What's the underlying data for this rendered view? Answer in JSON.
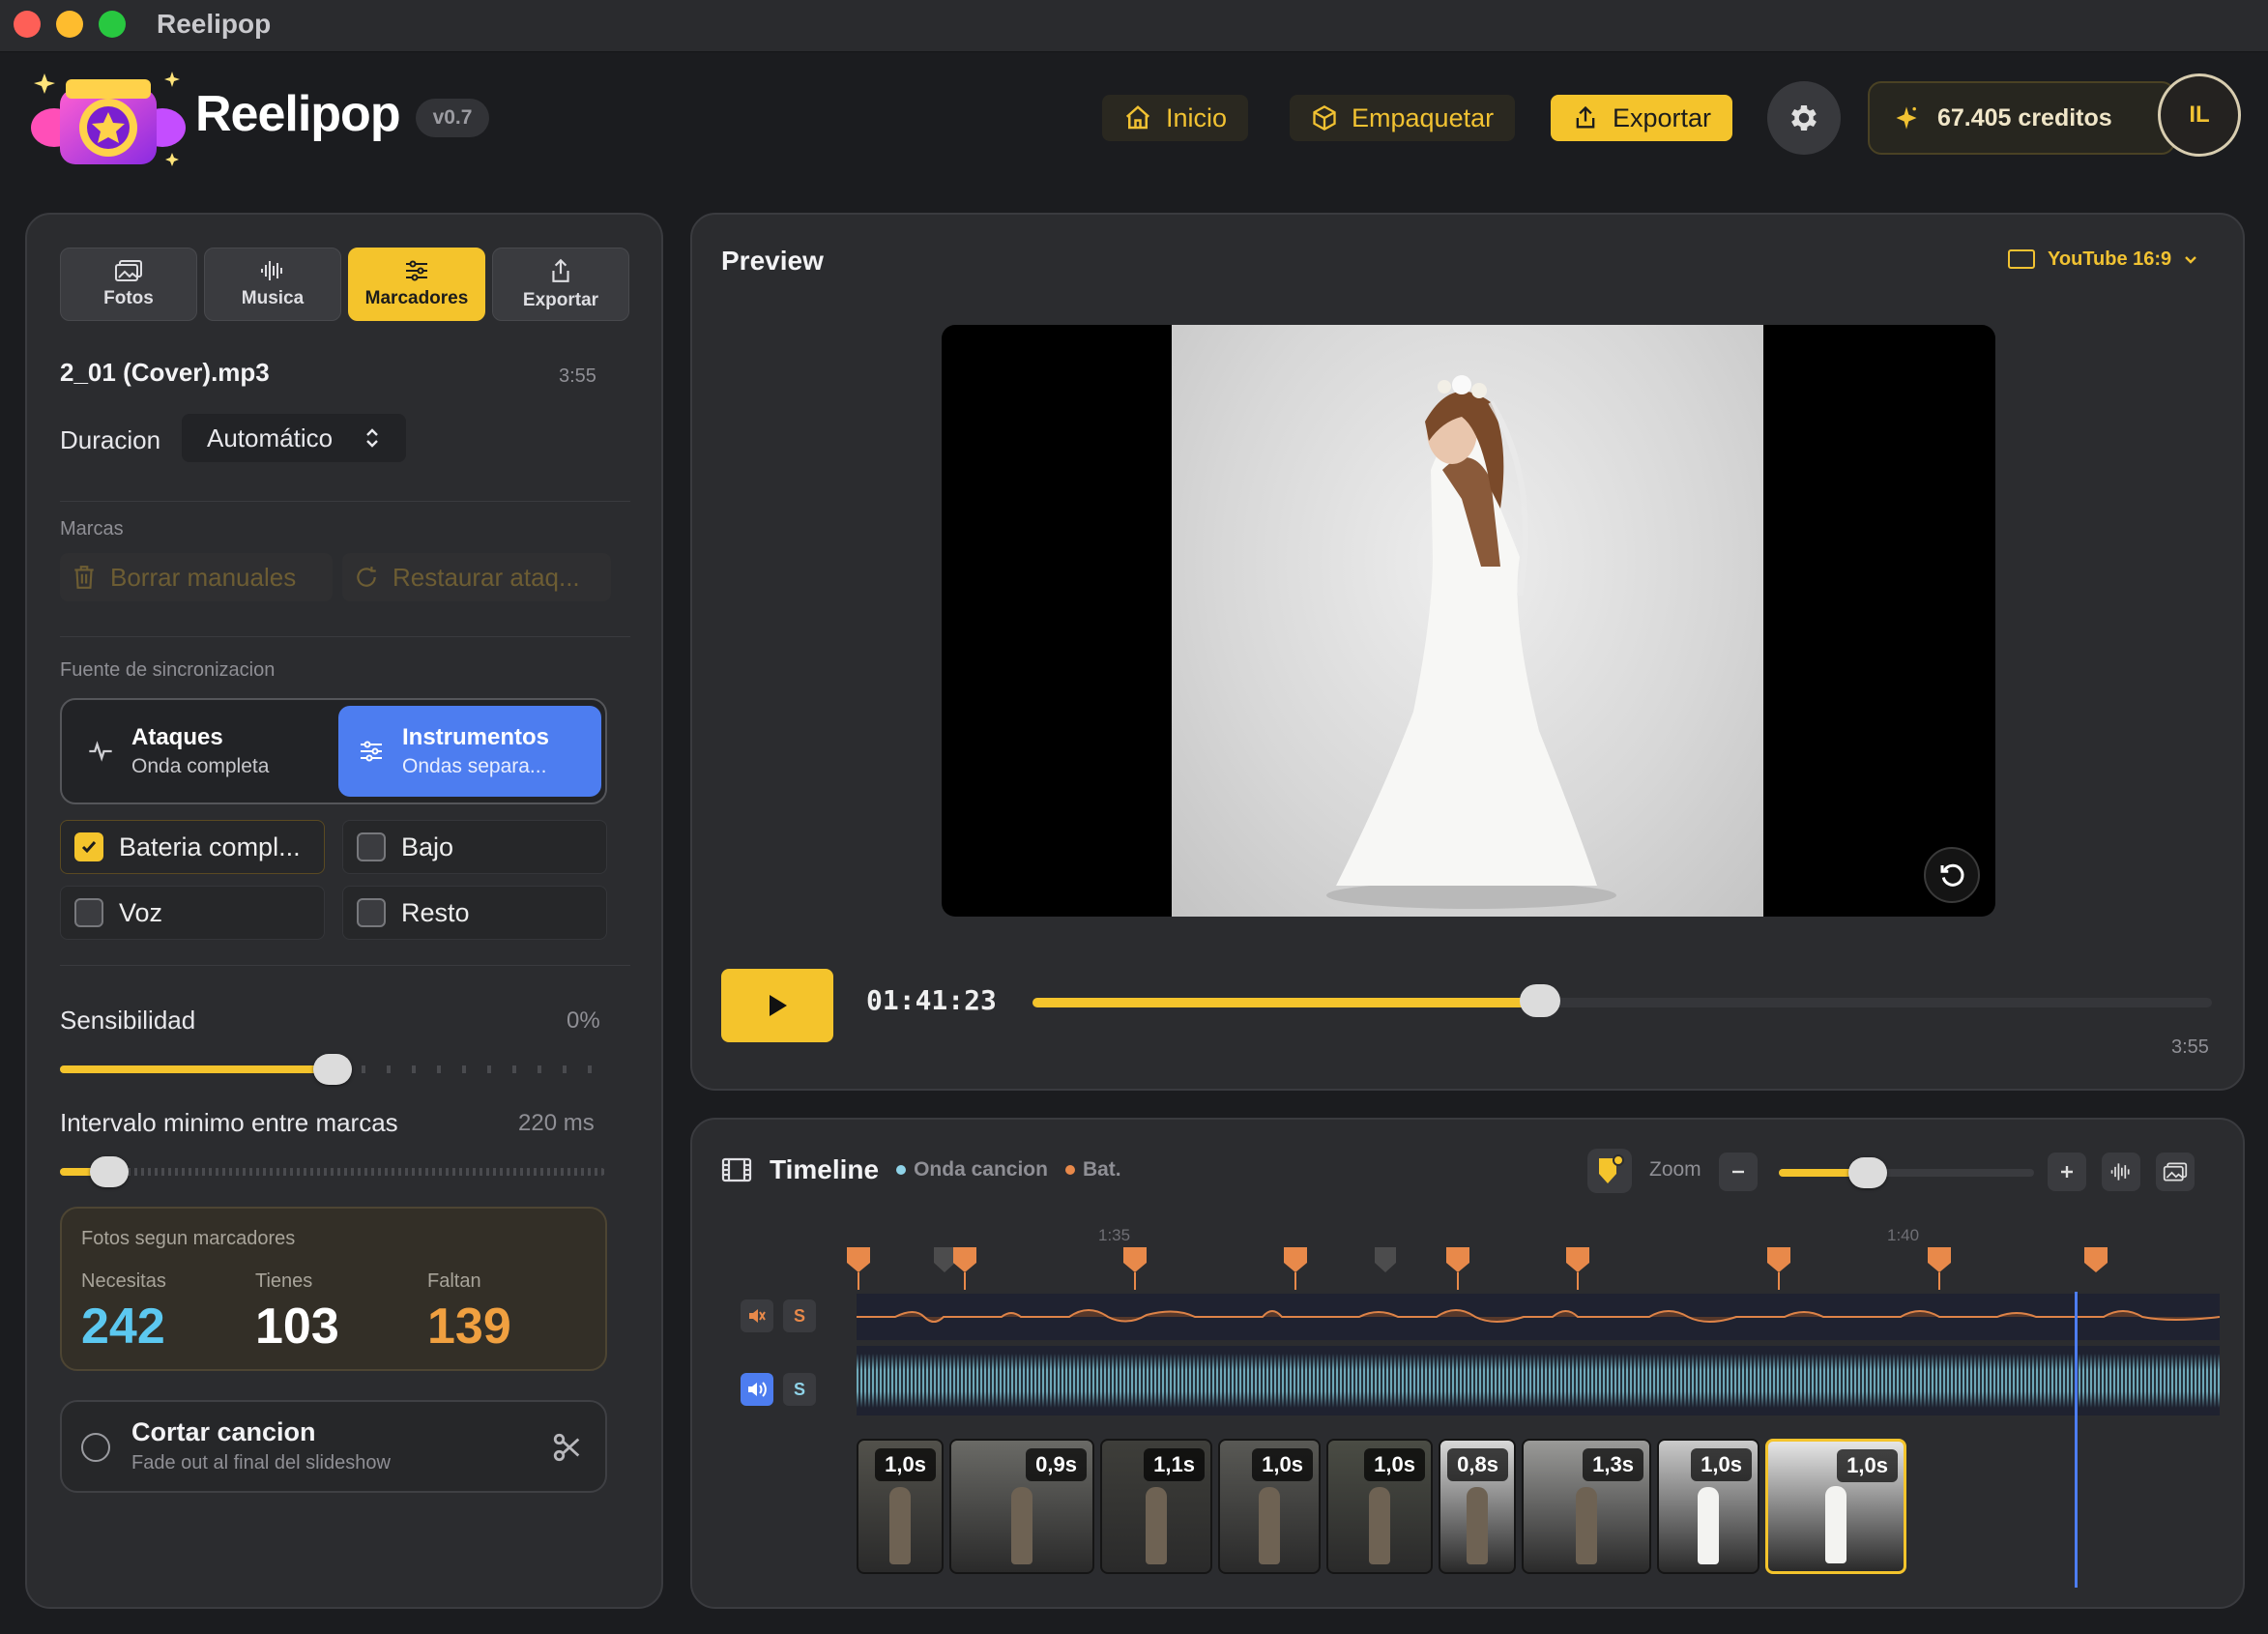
{
  "window": {
    "title": "Reelipop"
  },
  "header": {
    "brand": "Reelipop",
    "version": "v0.7",
    "nav": {
      "inicio": "Inicio",
      "empaquetar": "Empaquetar",
      "exportar": "Exportar"
    },
    "credits": "67.405 creditos",
    "avatar": "IL"
  },
  "sidebar": {
    "tabs": [
      {
        "label": "Fotos",
        "icon": "photos-icon"
      },
      {
        "label": "Musica",
        "icon": "waveform-icon"
      },
      {
        "label": "Marcadores",
        "icon": "sliders-icon"
      },
      {
        "label": "Exportar",
        "icon": "share-icon"
      }
    ],
    "active_tab": "Marcadores",
    "song": {
      "name": "2_01 (Cover).mp3",
      "duration": "3:55"
    },
    "duration_label": "Duracion",
    "duration_value": "Automático",
    "marks_label": "Marcas",
    "marks_buttons": {
      "clear": "Borrar manuales",
      "restore": "Restaurar ataq..."
    },
    "sync_label": "Fuente de sincronizacion",
    "sync_options": [
      {
        "title": "Ataques",
        "subtitle": "Onda completa",
        "selected": false
      },
      {
        "title": "Instrumentos",
        "subtitle": "Ondas separa...",
        "selected": true
      }
    ],
    "stems": [
      {
        "label": "Bateria compl...",
        "checked": true
      },
      {
        "label": "Bajo",
        "checked": false
      },
      {
        "label": "Voz",
        "checked": false
      },
      {
        "label": "Resto",
        "checked": false
      }
    ],
    "sensitivity": {
      "label": "Sensibilidad",
      "value": "0%",
      "level": 0.5
    },
    "min_interval": {
      "label": "Intervalo minimo entre marcas",
      "value": "220 ms",
      "level": 0.09
    },
    "stats": {
      "title": "Fotos segun marcadores",
      "needed_label": "Necesitas",
      "needed": "242",
      "have_label": "Tienes",
      "have": "103",
      "missing_label": "Faltan",
      "missing": "139"
    },
    "cut": {
      "title": "Cortar cancion",
      "subtitle": "Fade out al final del slideshow"
    }
  },
  "preview": {
    "title": "Preview",
    "aspect": "YouTube 16:9",
    "timecode": "01:41:23",
    "total": "3:55",
    "progress": 0.43
  },
  "timeline": {
    "title": "Timeline",
    "legend": [
      {
        "label": "Onda cancion",
        "color": "#8fd3e8"
      },
      {
        "label": "Bat.",
        "color": "#e8894a"
      }
    ],
    "zoom_label": "Zoom",
    "zoom_level": 0.35,
    "ruler": [
      "1:35",
      "1:40"
    ],
    "tracks": [
      {
        "solo": "S"
      },
      {
        "solo": "S"
      }
    ],
    "clips": [
      "1,0s",
      "0,9s",
      "1,1s",
      "1,0s",
      "1,0s",
      "0,8s",
      "1,3s",
      "1,0s",
      "1,0s"
    ]
  },
  "colors": {
    "accent": "#f4c42c",
    "blue": "#4d7df0",
    "needed": "#5cc8f0",
    "missing": "#f0a040"
  }
}
